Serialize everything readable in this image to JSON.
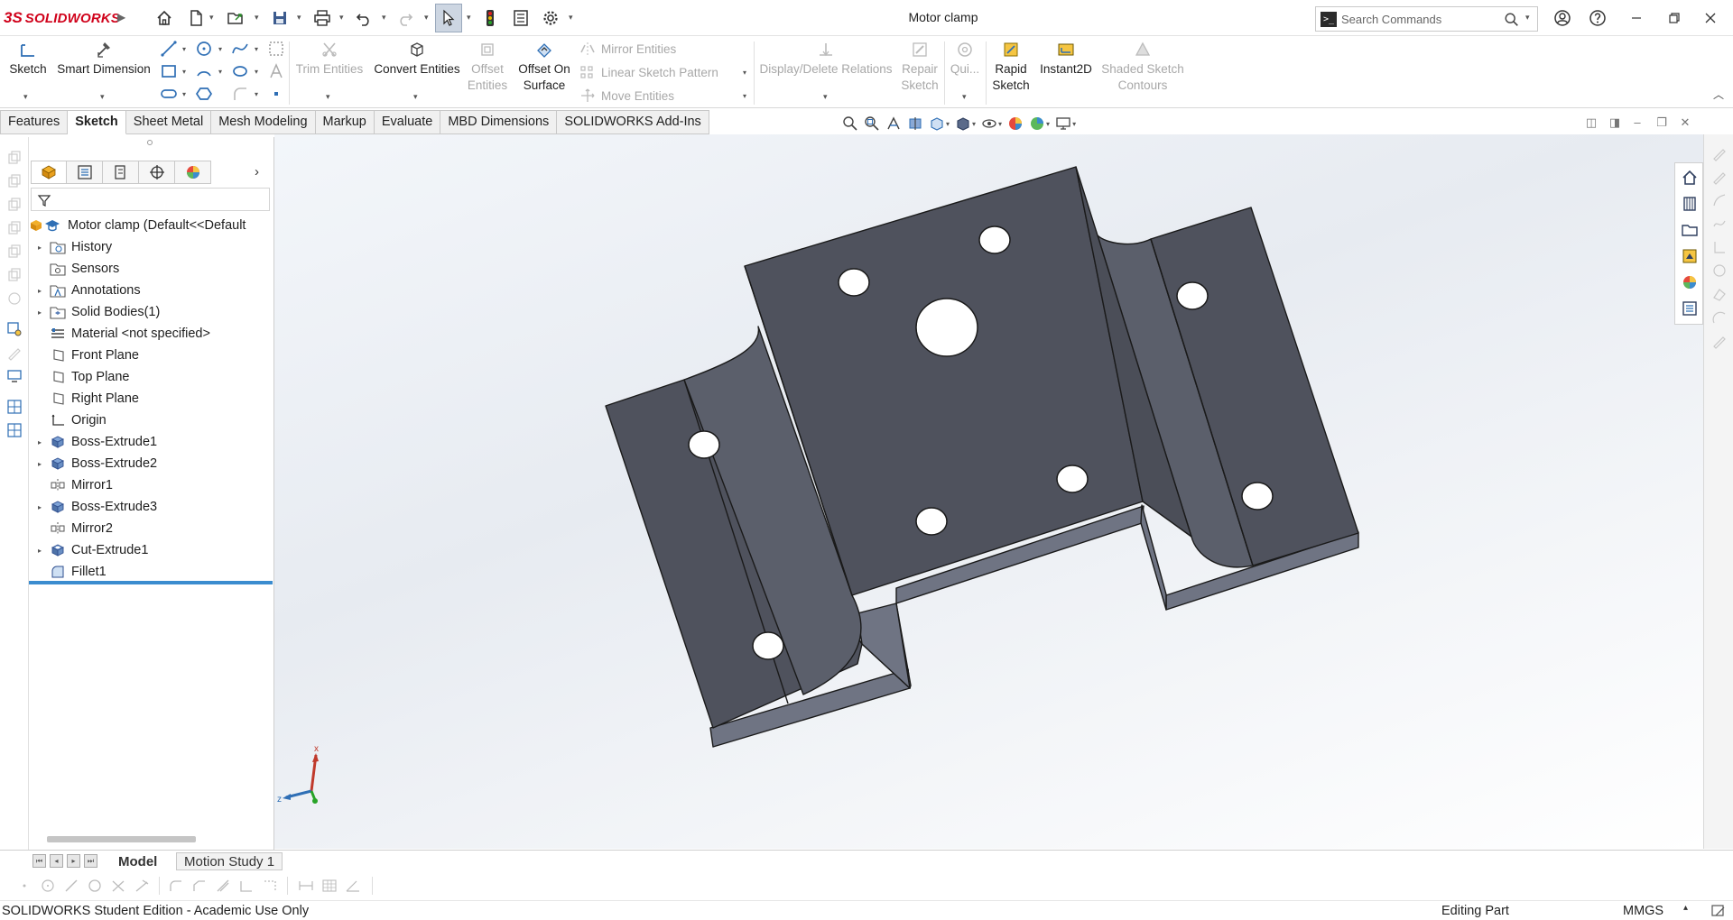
{
  "app": {
    "logo_prefix": "3S",
    "logo_text": "SOLIDWORKS",
    "document_title": "Motor clamp"
  },
  "search": {
    "placeholder": "Search Commands"
  },
  "command_manager": {
    "sketch": "Sketch",
    "smart_dimension": "Smart Dimension",
    "trim_entities": "Trim Entities",
    "convert_entities": "Convert Entities",
    "offset_entities_1": "Offset",
    "offset_entities_2": "Entities",
    "offset_on_surface_1": "Offset On",
    "offset_on_surface_2": "Surface",
    "mirror_entities": "Mirror Entities",
    "linear_sketch_pattern": "Linear Sketch Pattern",
    "move_entities": "Move Entities",
    "display_delete_relations": "Display/Delete Relations",
    "repair_sketch_1": "Repair",
    "repair_sketch_2": "Sketch",
    "quick_snaps": "Qui...",
    "rapid_sketch_1": "Rapid",
    "rapid_sketch_2": "Sketch",
    "instant2d": "Instant2D",
    "shaded_sketch_contours_1": "Shaded Sketch",
    "shaded_sketch_contours_2": "Contours"
  },
  "tabs": [
    "Features",
    "Sketch",
    "Sheet Metal",
    "Mesh Modeling",
    "Markup",
    "Evaluate",
    "MBD Dimensions",
    "SOLIDWORKS Add-Ins"
  ],
  "active_tab": "Sketch",
  "feature_tree": {
    "root": "Motor clamp  (Default<<Default",
    "items": [
      {
        "label": "History",
        "icon": "history-folder-icon",
        "expandable": true
      },
      {
        "label": "Sensors",
        "icon": "sensors-icon",
        "expandable": false
      },
      {
        "label": "Annotations",
        "icon": "annotations-icon",
        "expandable": true
      },
      {
        "label": "Solid Bodies(1)",
        "icon": "solid-bodies-icon",
        "expandable": true
      },
      {
        "label": "Material <not specified>",
        "icon": "material-icon",
        "expandable": false
      },
      {
        "label": "Front Plane",
        "icon": "plane-icon",
        "expandable": false
      },
      {
        "label": "Top Plane",
        "icon": "plane-icon",
        "expandable": false
      },
      {
        "label": "Right Plane",
        "icon": "plane-icon",
        "expandable": false
      },
      {
        "label": "Origin",
        "icon": "origin-icon",
        "expandable": false
      },
      {
        "label": "Boss-Extrude1",
        "icon": "boss-extrude-icon",
        "expandable": true
      },
      {
        "label": "Boss-Extrude2",
        "icon": "boss-extrude-icon",
        "expandable": true
      },
      {
        "label": "Mirror1",
        "icon": "mirror-icon",
        "expandable": false
      },
      {
        "label": "Boss-Extrude3",
        "icon": "boss-extrude-icon",
        "expandable": true
      },
      {
        "label": "Mirror2",
        "icon": "mirror-icon",
        "expandable": false
      },
      {
        "label": "Cut-Extrude1",
        "icon": "cut-extrude-icon",
        "expandable": true
      },
      {
        "label": "Fillet1",
        "icon": "fillet-icon",
        "expandable": false
      }
    ]
  },
  "bottom_tabs": [
    "Model",
    "Motion Study 1"
  ],
  "active_bottom_tab": "Model",
  "triad": {
    "x": "x",
    "z": "z"
  },
  "status": {
    "left": "SOLIDWORKS Student Edition - Academic Use Only",
    "mode": "Editing Part",
    "units": "MMGS"
  },
  "colors": {
    "model_face": "#4f525d",
    "model_side": "#6f7483",
    "accent_blue": "#3b8ccf",
    "brand_red": "#d0021b"
  }
}
